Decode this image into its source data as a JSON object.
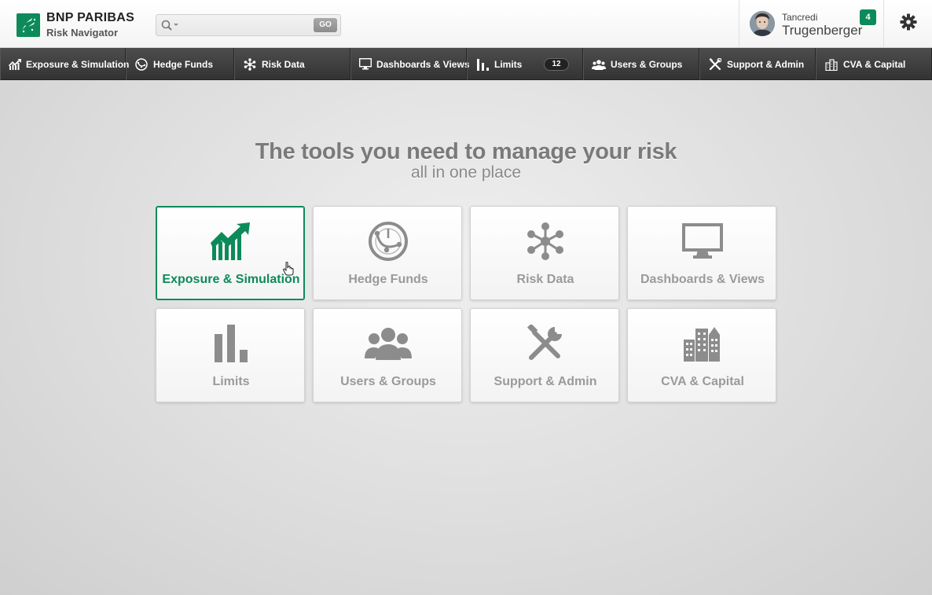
{
  "header": {
    "brand_name": "BNP PARIBAS",
    "brand_sub": "Risk Navigator",
    "search_placeholder": "",
    "search_go": "GO",
    "user_first": "Tancredi",
    "user_last": "Trugenberger",
    "notification_count": "4"
  },
  "nav": {
    "items": [
      {
        "label": "Exposure & Simulation",
        "icon": "trend-chart-icon"
      },
      {
        "label": "Hedge Funds",
        "icon": "hedge-funds-icon"
      },
      {
        "label": "Risk Data",
        "icon": "network-icon"
      },
      {
        "label": "Dashboards & Views",
        "icon": "monitor-icon"
      },
      {
        "label": "Limits",
        "icon": "bar-chart-icon",
        "badge": "12"
      },
      {
        "label": "Users & Groups",
        "icon": "users-icon"
      },
      {
        "label": "Support & Admin",
        "icon": "tools-icon"
      },
      {
        "label": "CVA & Capital",
        "icon": "buildings-icon"
      }
    ]
  },
  "main": {
    "headline": "The tools you need to manage your risk",
    "subline": "all in one place",
    "tiles": [
      {
        "label": "Exposure & Simulation",
        "icon": "trend-chart-icon",
        "active": true
      },
      {
        "label": "Hedge Funds",
        "icon": "hedge-funds-icon",
        "active": false
      },
      {
        "label": "Risk Data",
        "icon": "network-icon",
        "active": false
      },
      {
        "label": "Dashboards & Views",
        "icon": "monitor-icon",
        "active": false
      },
      {
        "label": "Limits",
        "icon": "bar-chart-icon",
        "active": false
      },
      {
        "label": "Users & Groups",
        "icon": "users-icon",
        "active": false
      },
      {
        "label": "Support & Admin",
        "icon": "tools-icon",
        "active": false
      },
      {
        "label": "CVA & Capital",
        "icon": "buildings-icon",
        "active": false
      }
    ]
  },
  "colors": {
    "accent": "#0d8a5a",
    "nav_bg": "#3f3f3f",
    "tile_text": "#9a9a9a"
  }
}
